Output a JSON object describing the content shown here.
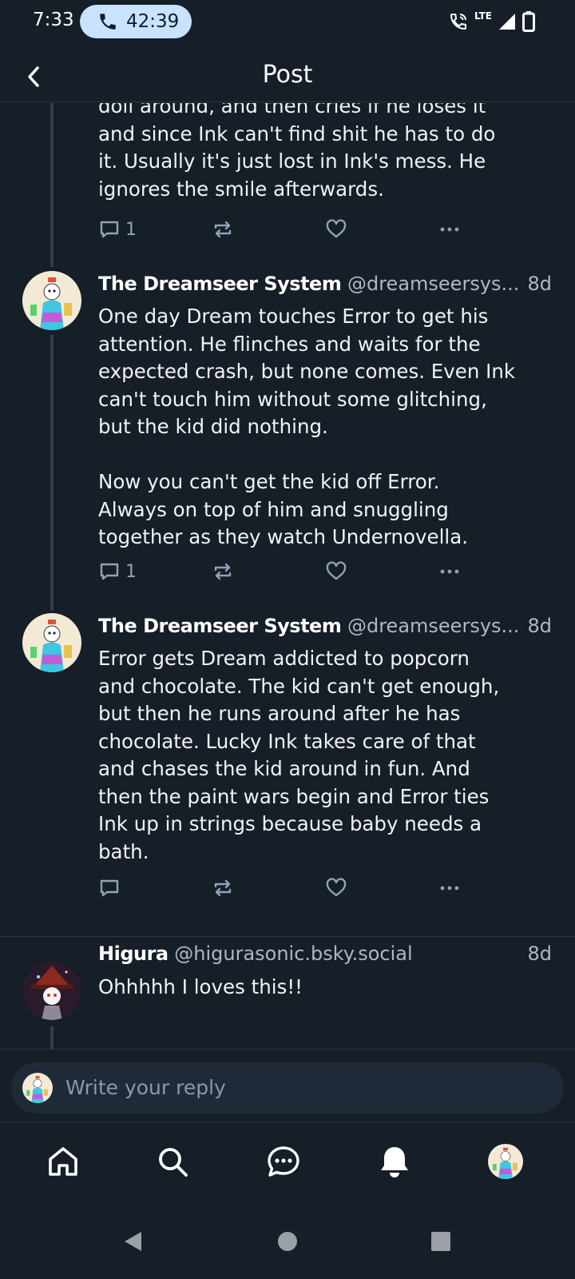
{
  "status_bar": {
    "time": "7:33",
    "call_duration": "42:39",
    "network": "LTE",
    "icons": [
      "phone-icon",
      "wifi-call-icon",
      "signal-icon",
      "battery-icon"
    ]
  },
  "header": {
    "title": "Post",
    "back_icon": "chevron-left-icon"
  },
  "posts": [
    {
      "text": "doll around, and then cries if he loses it\nand since Ink can't find shit he has to do\nit. Usually it's just lost in Ink's mess. He\nignores the smile afterwards.",
      "reply_count": "1"
    },
    {
      "author": "The Dreamseer System",
      "handle": "@dreamseersys...",
      "time": "8d",
      "text": "One day Dream touches Error to get his\nattention. He flinches and waits for the\nexpected crash, but none comes. Even Ink\ncan't touch him without some glitching,\nbut the kid did nothing.\n\nNow you can't get the kid off Error.\nAlways on top of him and snuggling\ntogether as they watch Undernovella.",
      "reply_count": "1"
    },
    {
      "author": "The Dreamseer System",
      "handle": "@dreamseersys...",
      "time": "8d",
      "text": "Error gets Dream addicted to popcorn\nand chocolate. The kid can't get enough,\nbut then he runs around after he has\nchocolate. Lucky Ink takes care of that\nand chases the kid around in fun. And\nthen the paint wars begin and Error ties\nInk up in strings because baby needs a\nbath.",
      "reply_count": ""
    },
    {
      "author": "Higura",
      "handle": "@higurasonic.bsky.social",
      "time": "8d",
      "text": "Ohhhhh I loves this!!"
    }
  ],
  "composer": {
    "placeholder": "Write your reply"
  },
  "nav": {
    "items": [
      "home-icon",
      "search-icon",
      "chat-icon",
      "bell-icon",
      "profile-avatar"
    ]
  },
  "colors": {
    "background": "#161e27",
    "action_icon": "#8fa3ba",
    "thread_line": "#2f3e50",
    "call_pill": "#c9e3ff"
  }
}
